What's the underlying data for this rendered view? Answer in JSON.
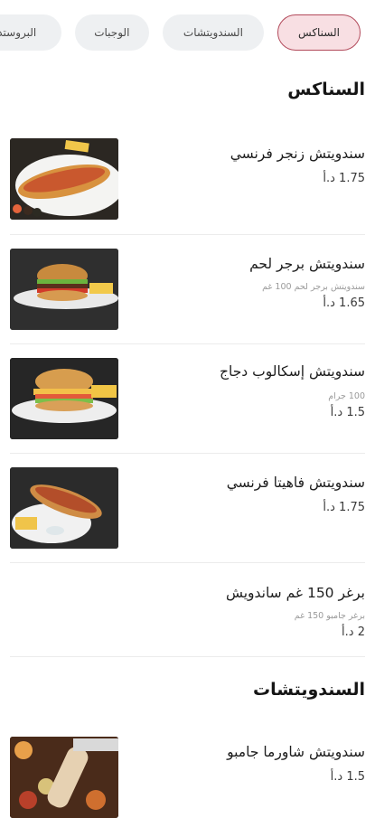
{
  "tabs": [
    {
      "label": "السناكس",
      "active": true
    },
    {
      "label": "السندويتشات",
      "active": false
    },
    {
      "label": "الوجبات",
      "active": false
    },
    {
      "label": "البروستد",
      "active": false
    }
  ],
  "sections": [
    {
      "title": "السناكس",
      "items": [
        {
          "name": "سندويتش زنجر فرنسي",
          "description": "",
          "price": "1.75 د.أ",
          "image": "french-zinger-sandwich"
        },
        {
          "name": "سندويتش برجر لحم",
          "description": "سندويتش برجر لحم 100 غم",
          "price": "1.65 د.أ",
          "image": "beef-burger"
        },
        {
          "name": "سندويتش إسكالوب دجاج",
          "description": "100 جرام",
          "price": "1.5 د.أ",
          "image": "chicken-escalope-burger"
        },
        {
          "name": "سندويتش فاهيتا فرنسي",
          "description": "",
          "price": "1.75 د.أ",
          "image": "french-fajita-sandwich"
        },
        {
          "name": "برغر 150 غم ساندويش",
          "description": "برغر جامبو 150 غم",
          "price": "2 د.أ",
          "image": ""
        }
      ]
    },
    {
      "title": "السندويتشات",
      "items": [
        {
          "name": "سندويتش شاورما جامبو",
          "description": "",
          "price": "1.5 د.أ",
          "image": "jumbo-shawarma-wrap"
        }
      ]
    }
  ]
}
